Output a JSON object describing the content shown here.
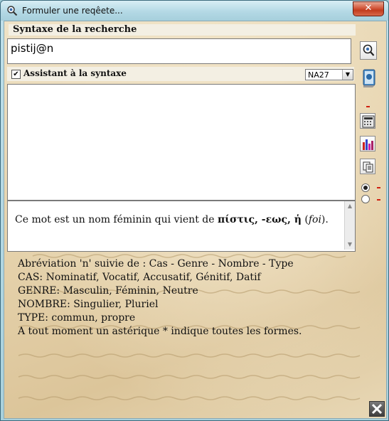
{
  "window": {
    "title": "Formuler une reqêete..."
  },
  "search": {
    "section_label": "Syntaxe de la recherche",
    "query_value": "pistij@n"
  },
  "assistant": {
    "label": "Assistant à la syntaxe",
    "checked": true,
    "edition_selected": "NA27"
  },
  "description": {
    "prefix": "Ce mot est un nom féminin qui vient de ",
    "greek": "πίστις, -εως, ἡ",
    "open": " (",
    "gloss": "foi",
    "close": ")."
  },
  "help": {
    "lines": [
      "Abréviation 'n' suivie de : Cas - Genre - Nombre - Type",
      "CAS: Nominatif, Vocatif, Accusatif, Génitif, Datif",
      "GENRE: Masculin, Féminin, Neutre",
      "NOMBRE: Singulier, Pluriel",
      "TYPE: commun, propre",
      "A tout moment un astérique * indique toutes les formes."
    ]
  },
  "toolbar": {
    "icons": [
      "search-icon",
      "book-icon",
      "calculator-icon",
      "bar-chart-icon",
      "copy-icon"
    ],
    "radio_selected": 0
  },
  "colors": {
    "accent_red": "#d02010",
    "parchment": "#e6d3ad",
    "title_bar": "#b4d9e5"
  }
}
